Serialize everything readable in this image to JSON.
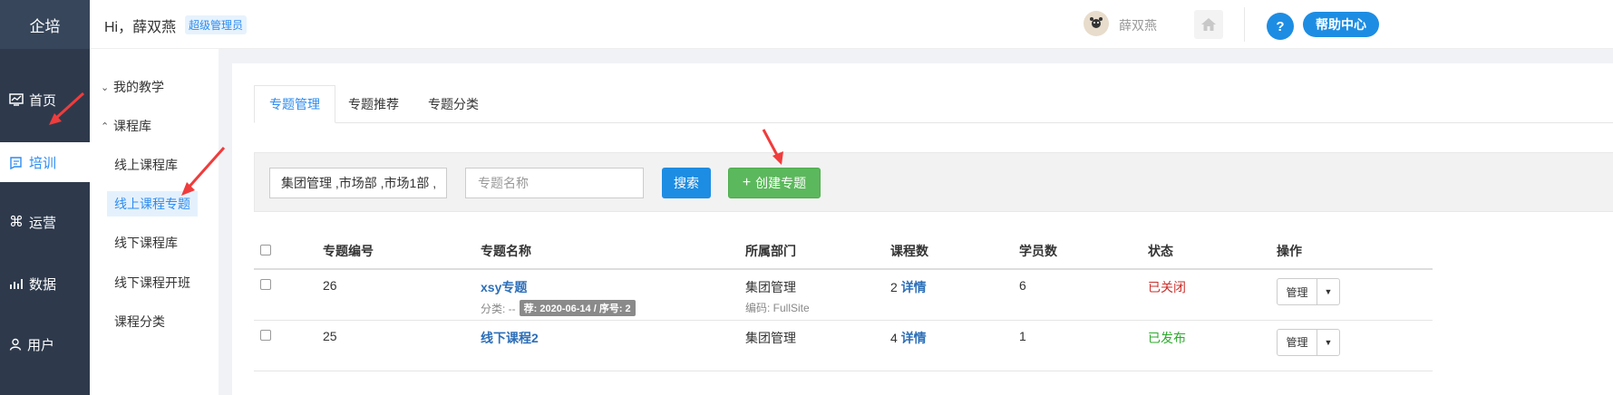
{
  "app": {
    "logo": "企培"
  },
  "sidebar": {
    "items": [
      {
        "label": "首页",
        "icon": "chart-icon"
      },
      {
        "label": "培训",
        "icon": "training-icon"
      },
      {
        "label": "运营",
        "icon": "command-icon"
      },
      {
        "label": "数据",
        "icon": "bar-chart-icon"
      },
      {
        "label": "用户",
        "icon": "user-icon"
      }
    ],
    "active_index": 1
  },
  "subnav": {
    "groups": [
      {
        "label": "我的教学",
        "expanded": false
      },
      {
        "label": "课程库",
        "expanded": true
      }
    ],
    "items": [
      "线上课程库",
      "线上课程专题",
      "线下课程库",
      "线下课程开班",
      "课程分类"
    ],
    "active_index": 1
  },
  "header": {
    "greeting": "Hi，薛双燕",
    "role": "超级管理员",
    "username": "薛双燕",
    "help": "帮助中心",
    "help_icon_text": "?"
  },
  "tabs": [
    "专题管理",
    "专题推荐",
    "专题分类"
  ],
  "filter": {
    "department_value": "集团管理 ,市场部 ,市场1部 ,",
    "name_placeholder": "专题名称",
    "search_label": "搜索",
    "create_label": "创建专题",
    "create_icon": "+"
  },
  "table": {
    "columns": [
      "专题编号",
      "专题名称",
      "所属部门",
      "课程数",
      "学员数",
      "状态",
      "操作"
    ],
    "detail_label": "详情",
    "manage_label": "管理",
    "rows": [
      {
        "id": "26",
        "name": "xsy专题",
        "category_label": "分类: --",
        "tag": "荐: 2020-06-14 / 序号: 2",
        "department": "集团管理",
        "code": "编码: FullSite",
        "course_count": "2",
        "student_count": "6",
        "status": "已关闭"
      },
      {
        "id": "25",
        "name": "线下课程2",
        "category_label": "",
        "tag": "",
        "department": "集团管理",
        "code": "",
        "course_count": "4",
        "student_count": "1",
        "status": "已发布"
      }
    ]
  },
  "colors": {
    "sidebar_bg": "#2e3a4c",
    "accent": "#2d8cf0",
    "create_green": "#5cb85c",
    "status_closed": "#c9302c",
    "status_published": "#2eaa2e",
    "annotation_arrow": "#f03c3c"
  }
}
